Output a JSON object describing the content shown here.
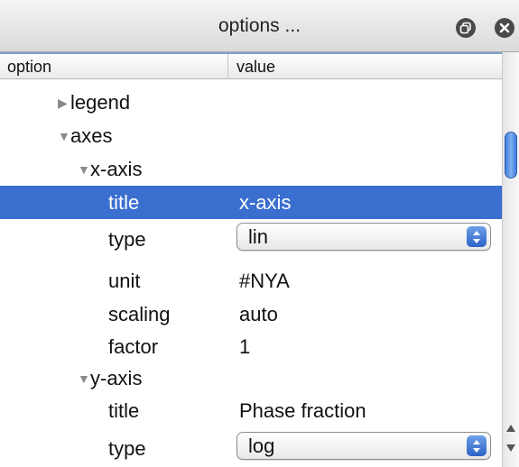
{
  "window": {
    "title": "options ..."
  },
  "header": {
    "option": "option",
    "value": "value"
  },
  "rows": [
    {
      "label": "legend",
      "expanded": false,
      "indent": 0
    },
    {
      "label": "axes",
      "expanded": true,
      "indent": 0
    },
    {
      "label": "x-axis",
      "expanded": true,
      "indent": 1
    },
    {
      "label": "title",
      "value": "x-axis",
      "selected": true
    },
    {
      "label": "type",
      "value": "lin",
      "control": "popup"
    },
    {
      "label": "unit",
      "value": "#NYA"
    },
    {
      "label": "scaling",
      "value": "auto"
    },
    {
      "label": "factor",
      "value": "1"
    },
    {
      "label": "y-axis",
      "expanded": true,
      "indent": 1
    },
    {
      "label": "title",
      "value": "Phase fraction"
    },
    {
      "label": "type",
      "value": "log",
      "control": "popup"
    }
  ],
  "colors": {
    "selection": "#3a6fcf",
    "header_accent": "#7fa4d3"
  },
  "icons": {
    "detach": "detach-icon",
    "close": "close-icon",
    "expanded": "triangle-down-icon",
    "collapsed": "triangle-right-icon",
    "popup": "up-down-arrows-icon"
  }
}
